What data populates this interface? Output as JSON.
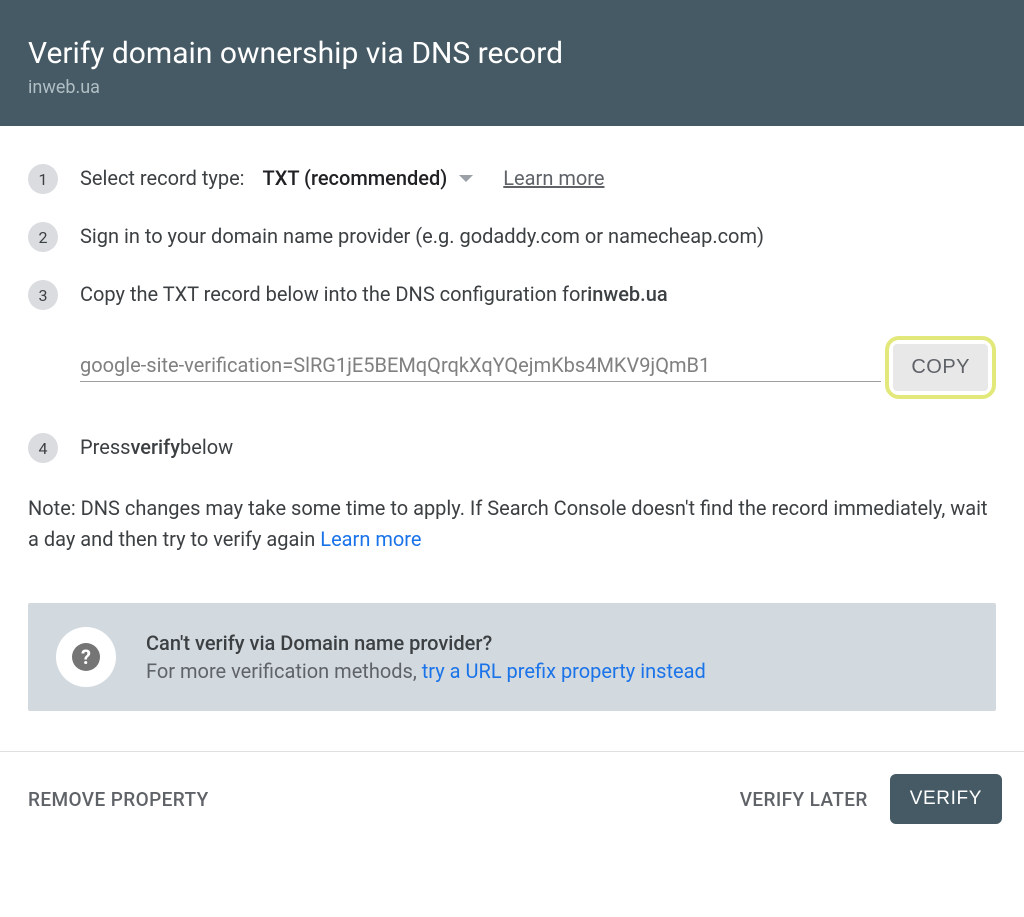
{
  "header": {
    "title": "Verify domain ownership via DNS record",
    "subtitle": "inweb.ua"
  },
  "steps": {
    "s1": {
      "num": "1",
      "label": "Select record type:",
      "dropdown": "TXT (recommended)",
      "learn_more": "Learn more"
    },
    "s2": {
      "num": "2",
      "text": "Sign in to your domain name provider (e.g. godaddy.com or namecheap.com)"
    },
    "s3": {
      "num": "3",
      "text_prefix": "Copy the TXT record below into the DNS configuration for ",
      "domain": "inweb.ua",
      "record": "google-site-verification=SlRG1jE5BEMqQrqkXqYQejmKbs4MKV9jQmB1",
      "copy_label": "COPY"
    },
    "s4": {
      "num": "4",
      "press": "Press ",
      "verify": "verify",
      "below": " below"
    }
  },
  "note": {
    "text": "Note: DNS changes may take some time to apply. If Search Console doesn't find the record immediately, wait a day and then try to verify again ",
    "link": "Learn more"
  },
  "help": {
    "icon": "?",
    "title": "Can't verify via Domain name provider?",
    "text_prefix": "For more verification methods, ",
    "link": "try a URL prefix property instead"
  },
  "footer": {
    "remove": "REMOVE PROPERTY",
    "verify_later": "VERIFY LATER",
    "verify": "VERIFY"
  }
}
